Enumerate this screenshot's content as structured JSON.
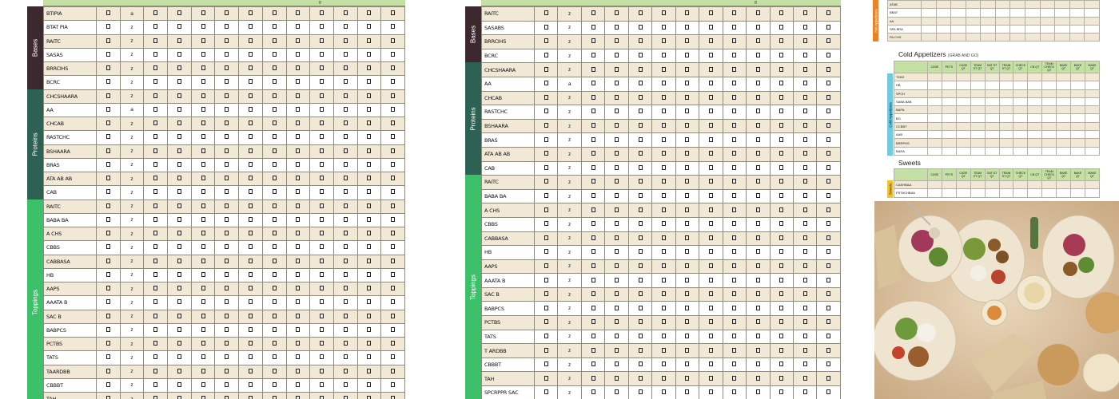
{
  "left_sheet": {
    "header_note": "g",
    "sections": [
      {
        "name": "Bases",
        "rows": [
          "BTIPIA",
          "BTAT PIA",
          "RAITC",
          "SASAS",
          "BRRCIHS",
          "BCRC"
        ]
      },
      {
        "name": "Proteins",
        "rows": [
          "CHCSHAARA",
          "AA",
          "CHCAB",
          "RASTCHC",
          "BSHAARA",
          "BRAS",
          "ATA AB AB",
          "CAB"
        ]
      },
      {
        "name": "Toppings",
        "rows": [
          "RAITC",
          "BABA BA",
          "A CHS",
          "CBBS",
          "CABBASA",
          "HB",
          "AAPS",
          "AAATA B",
          "SAC B",
          "BABPCS",
          "PCTBS",
          "TATS",
          "TAARDBB",
          "CBBBT",
          "TAH"
        ]
      }
    ],
    "qty_values": [
      "a",
      "z",
      "z",
      "z",
      "z",
      "z",
      "z",
      "a",
      "z",
      "z",
      "z",
      "z",
      "z",
      "z",
      "z",
      "z",
      "z",
      "z",
      "z",
      "z",
      "z",
      "z",
      "z",
      "z",
      "z",
      "z",
      "z",
      "z",
      "z"
    ],
    "columns": 13
  },
  "mid_sheet": {
    "header_note": "g",
    "sections": [
      {
        "name": "Bases",
        "rows": [
          "RAITC",
          "SASABS",
          "BRRCIHS",
          "BCRC"
        ]
      },
      {
        "name": "Proteins",
        "rows": [
          "CHCSHAARA",
          "AA",
          "CHCAB",
          "RASTCHC",
          "BSHAARA",
          "BRAS",
          "ATA AB AB",
          "CAB"
        ]
      },
      {
        "name": "Toppings",
        "rows": [
          "RAITC",
          "BABA BA",
          "A CHS",
          "CBBS",
          "CABBASA",
          "HB",
          "AAPS",
          "AAATA B",
          "SAC B",
          "BABPCS",
          "PCTBS",
          "TATS",
          "T ARDBB",
          "CBBBT",
          "TAH",
          "SPCRPPR SAC"
        ]
      }
    ],
    "qty_values": [
      "z",
      "z",
      "z",
      "z",
      "z",
      "a",
      "z",
      "z",
      "z",
      "z",
      "z",
      "z",
      "z",
      "z",
      "z",
      "z",
      "z",
      "z",
      "z",
      "z",
      "z",
      "z",
      "z",
      "z",
      "z",
      "z",
      "z",
      "z"
    ],
    "columns": 13
  },
  "right_col": {
    "top_table": {
      "band_label": "Hot Appetizers",
      "rows": [
        "ATAB",
        "BBAT",
        "AA",
        "SPA BRA",
        "PA CHS"
      ]
    },
    "cold": {
      "title": "Cold Appetizers",
      "subtitle": "(GRAB AND GO)",
      "band_label": "Cold Appetizers",
      "headers": [
        "",
        "CASE",
        "PKTS",
        "CASE QT",
        "TEAM ST QT",
        "SAT ST QT",
        "TRAIN ST QT",
        "CHECK QT",
        "CB QT",
        "TEAM CHECK QT",
        "BAKE QT",
        "BAKE QT",
        "MAKE QT"
      ],
      "rows": [
        "TZAS",
        "HB",
        "SPCH",
        "SABA BAB",
        "BAPA",
        "BO",
        "CCBBT",
        "AAB",
        "BRRPHS",
        "BARA"
      ]
    },
    "sweets": {
      "title": "Sweets",
      "band_label": "Sweets",
      "headers": [
        "",
        "CASE",
        "PKTS",
        "CASE QT",
        "TEAM ST QT",
        "SAT ST QT",
        "TRAIN ST QT",
        "CHECK QT",
        "CB QT",
        "TEAM CHECK QT",
        "BAKE QT",
        "BAKE QT",
        "MAKE QT"
      ],
      "rows": [
        "CASHBAA",
        "PSTACHBAA"
      ]
    }
  },
  "colors": {
    "header_green": "#c5e0a4",
    "row_beige": "#f2e8d6",
    "bases_band": "#3d2830",
    "proteins_band": "#2d6154",
    "toppings_band": "#3cc06a",
    "cold_band": "#6ecbe0",
    "sweets_band": "#f1c232",
    "hot_band": "#e8832a"
  }
}
